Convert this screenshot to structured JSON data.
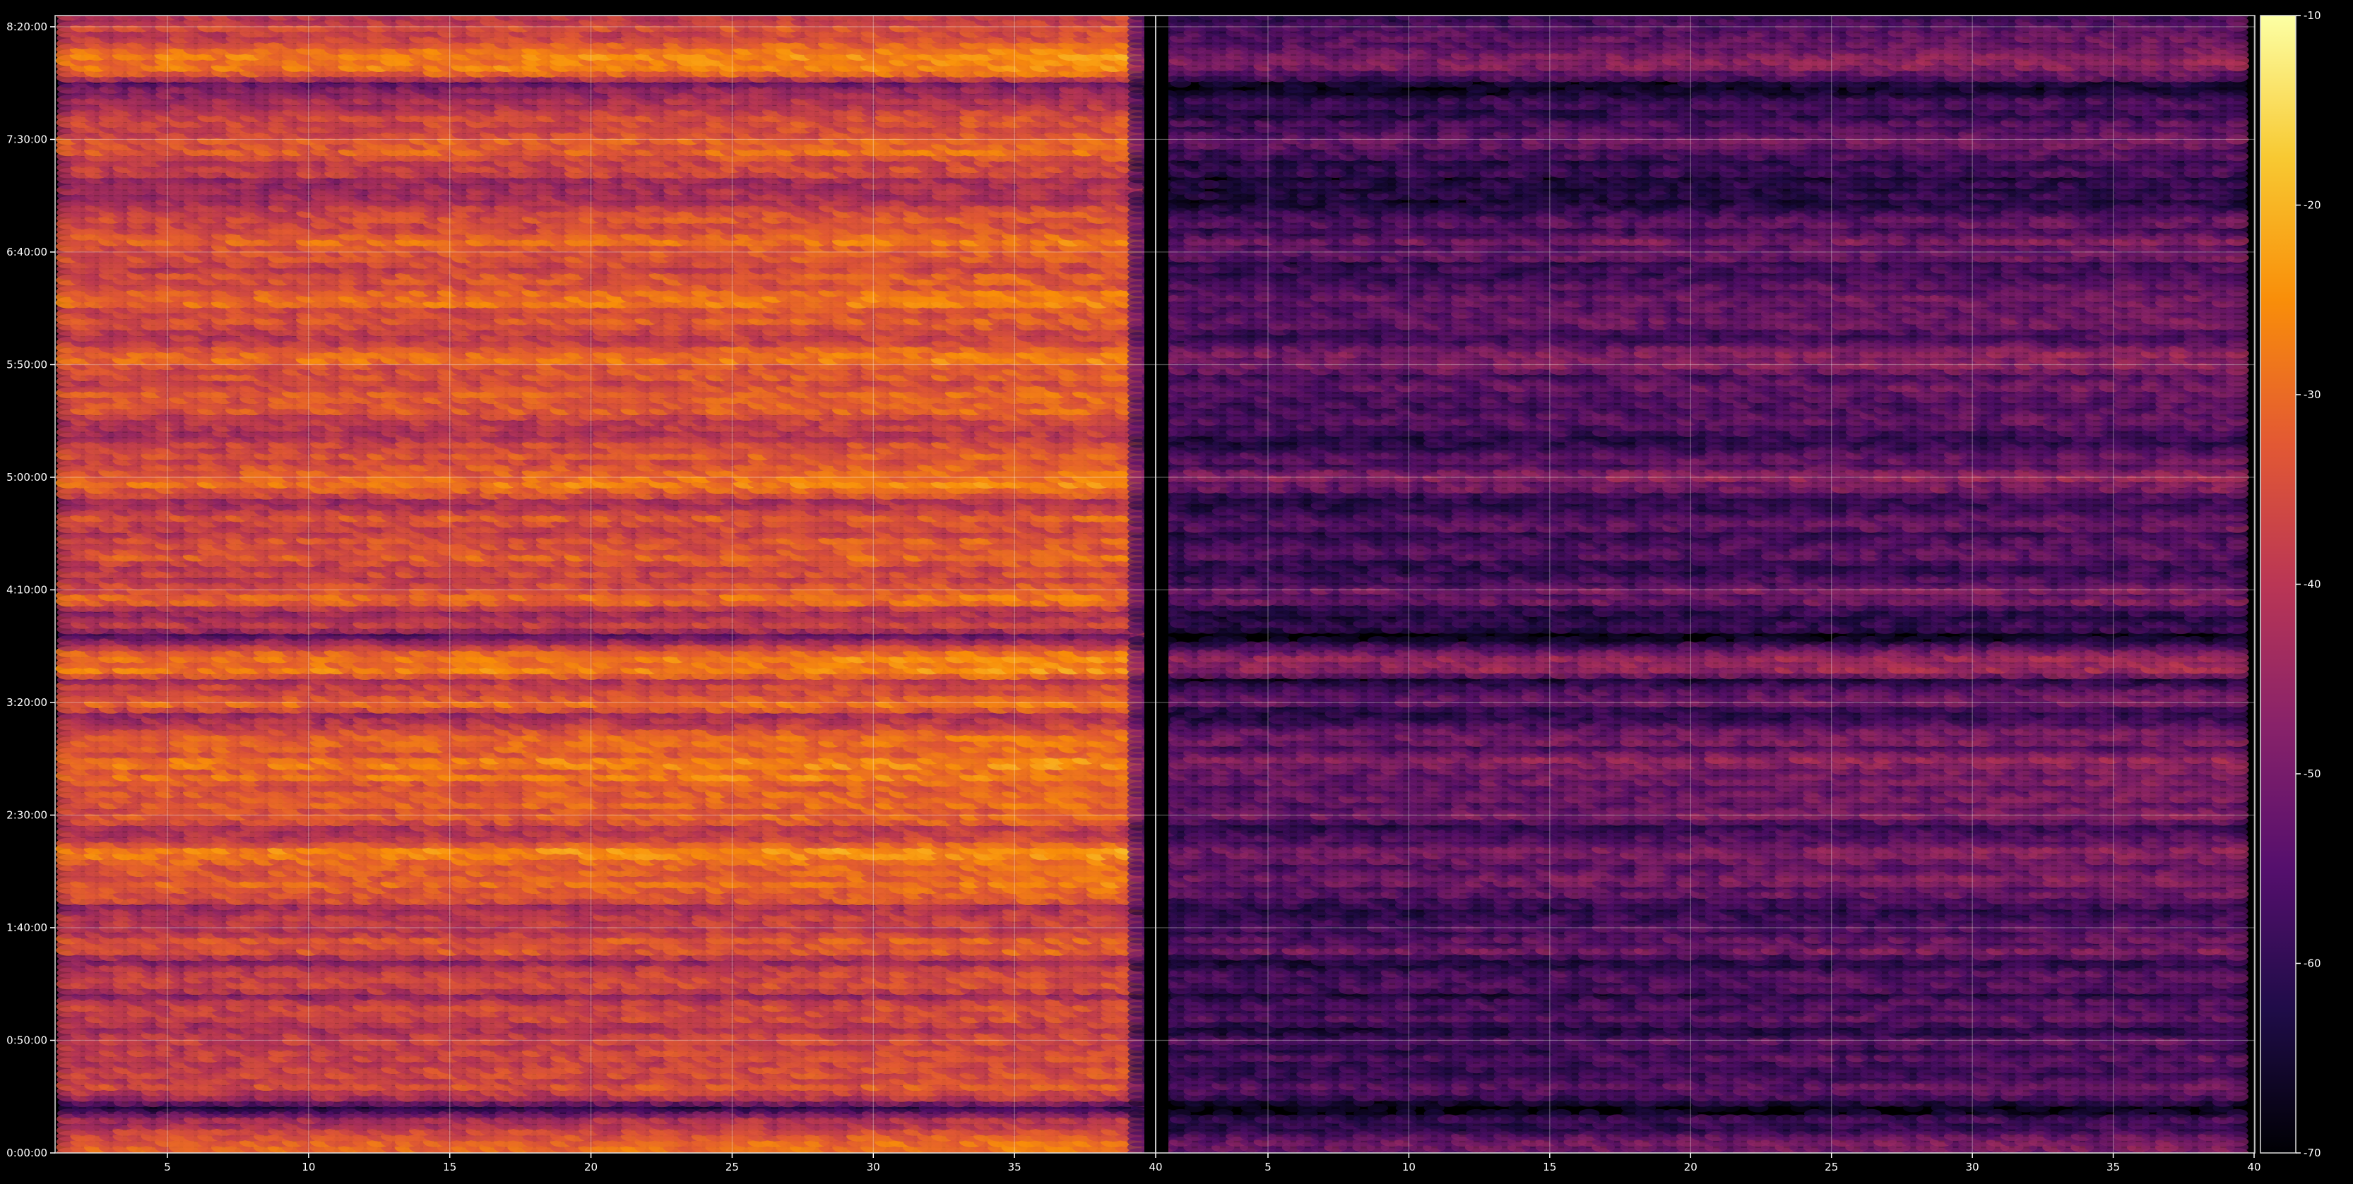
{
  "chart_data": {
    "type": "heatmap",
    "title": "",
    "xlabel": "",
    "ylabel": "",
    "panels": [
      {
        "name": "",
        "xlim": [
          1.5,
          39.7
        ]
      },
      {
        "name": "",
        "xlim": [
          0.4,
          39.7
        ]
      }
    ],
    "x_axis_ticks": [
      {
        "label": "5",
        "panel": 1,
        "value": 5
      },
      {
        "label": "10",
        "panel": 1,
        "value": 10
      },
      {
        "label": "15",
        "panel": 1,
        "value": 15
      },
      {
        "label": "20",
        "panel": 1,
        "value": 20
      },
      {
        "label": "25",
        "panel": 1,
        "value": 25
      },
      {
        "label": "30",
        "panel": 1,
        "value": 30
      },
      {
        "label": "35",
        "panel": 1,
        "value": 35
      },
      {
        "label": "40",
        "panel": 1,
        "value": 40
      },
      {
        "label": "5",
        "panel": 2,
        "value": 5
      },
      {
        "label": "10",
        "panel": 2,
        "value": 10
      },
      {
        "label": "15",
        "panel": 2,
        "value": 15
      },
      {
        "label": "20",
        "panel": 2,
        "value": 20
      },
      {
        "label": "25",
        "panel": 2,
        "value": 25
      },
      {
        "label": "30",
        "panel": 2,
        "value": 30
      },
      {
        "label": "35",
        "panel": 2,
        "value": 35
      },
      {
        "label": "40",
        "panel": 2,
        "value": 40
      }
    ],
    "y_axis": {
      "unit": "minutes",
      "ylim": [
        0,
        505
      ],
      "ticks": [
        {
          "label": "0:00:00",
          "value": 0
        },
        {
          "label": "0:50:00",
          "value": 50
        },
        {
          "label": "1:40:00",
          "value": 100
        },
        {
          "label": "2:30:00",
          "value": 150
        },
        {
          "label": "3:20:00",
          "value": 200
        },
        {
          "label": "4:10:00",
          "value": 250
        },
        {
          "label": "5:00:00",
          "value": 300
        },
        {
          "label": "5:50:00",
          "value": 350
        },
        {
          "label": "6:40:00",
          "value": 400
        },
        {
          "label": "7:30:00",
          "value": 450
        },
        {
          "label": "8:20:00",
          "value": 500
        }
      ]
    },
    "colorbar": {
      "colormap": "inferno",
      "range": [
        -70,
        -10
      ],
      "ticks": [
        {
          "label": "-10",
          "value": -10
        },
        {
          "label": "-20",
          "value": -20
        },
        {
          "label": "-30",
          "value": -30
        },
        {
          "label": "-40",
          "value": -40
        },
        {
          "label": "-50",
          "value": -50
        },
        {
          "label": "-60",
          "value": -60
        },
        {
          "label": "-70",
          "value": -70
        }
      ]
    },
    "grid": true,
    "row_profile": {
      "time_min": [
        0,
        5,
        10,
        15,
        20,
        25,
        30,
        35,
        40,
        45,
        50,
        55,
        60,
        65,
        70,
        75,
        80,
        85,
        90,
        95,
        100,
        105,
        110,
        115,
        120,
        125,
        130,
        135,
        140,
        145,
        150,
        155,
        160,
        165,
        170,
        175,
        180,
        185,
        190,
        195,
        200,
        205,
        210,
        215,
        220,
        225,
        230,
        235,
        240,
        245,
        250,
        255,
        260,
        265,
        270,
        275,
        280,
        285,
        290,
        295,
        300,
        305,
        310,
        315,
        320,
        325,
        330,
        335,
        340,
        345,
        350,
        355,
        360,
        365,
        370,
        375,
        380,
        385,
        390,
        395,
        400,
        405,
        410,
        415,
        420,
        425,
        430,
        435,
        440,
        445,
        450,
        455,
        460,
        465,
        470,
        475,
        480,
        485,
        490,
        495,
        500,
        505
      ],
      "panel_1_level": [
        -32,
        -30,
        -38,
        -42,
        -58,
        -40,
        -36,
        -34,
        -35,
        -38,
        -37,
        -42,
        -36,
        -35,
        -46,
        -33,
        -36,
        -48,
        -32,
        -33,
        -38,
        -36,
        -42,
        -31,
        -30,
        -33,
        -29,
        -28,
        -36,
        -40,
        -30,
        -33,
        -32,
        -29,
        -31,
        -28,
        -33,
        -31,
        -36,
        -42,
        -30,
        -35,
        -41,
        -27,
        -27,
        -38,
        -52,
        -37,
        -44,
        -32,
        -32,
        -36,
        -40,
        -33,
        -33,
        -37,
        -34,
        -36,
        -41,
        -31,
        -28,
        -35,
        -34,
        -38,
        -40,
        -36,
        -34,
        -32,
        -33,
        -35,
        -32,
        -29,
        -38,
        -36,
        -33,
        -32,
        -30,
        -34,
        -36,
        -38,
        -32,
        -30,
        -35,
        -36,
        -40,
        -43,
        -44,
        -38,
        -38,
        -33,
        -31,
        -36,
        -38,
        -40,
        -42,
        -48,
        -30,
        -27,
        -29,
        -34,
        -34,
        -38
      ],
      "panel_2_level": [
        -50,
        -48,
        -56,
        -58,
        -68,
        -58,
        -54,
        -54,
        -55,
        -56,
        -55,
        -60,
        -55,
        -54,
        -62,
        -52,
        -55,
        -63,
        -51,
        -52,
        -57,
        -55,
        -60,
        -50,
        -50,
        -52,
        -49,
        -48,
        -56,
        -60,
        -48,
        -52,
        -51,
        -48,
        -50,
        -47,
        -52,
        -50,
        -55,
        -60,
        -49,
        -54,
        -59,
        -46,
        -46,
        -57,
        -66,
        -56,
        -62,
        -51,
        -51,
        -55,
        -58,
        -52,
        -52,
        -56,
        -53,
        -55,
        -59,
        -50,
        -46,
        -54,
        -53,
        -57,
        -58,
        -55,
        -53,
        -51,
        -52,
        -54,
        -50,
        -48,
        -57,
        -55,
        -52,
        -51,
        -49,
        -53,
        -55,
        -57,
        -51,
        -49,
        -54,
        -55,
        -59,
        -61,
        -62,
        -57,
        -57,
        -52,
        -50,
        -55,
        -57,
        -59,
        -60,
        -64,
        -49,
        -46,
        -48,
        -53,
        -53,
        -57
      ]
    }
  }
}
